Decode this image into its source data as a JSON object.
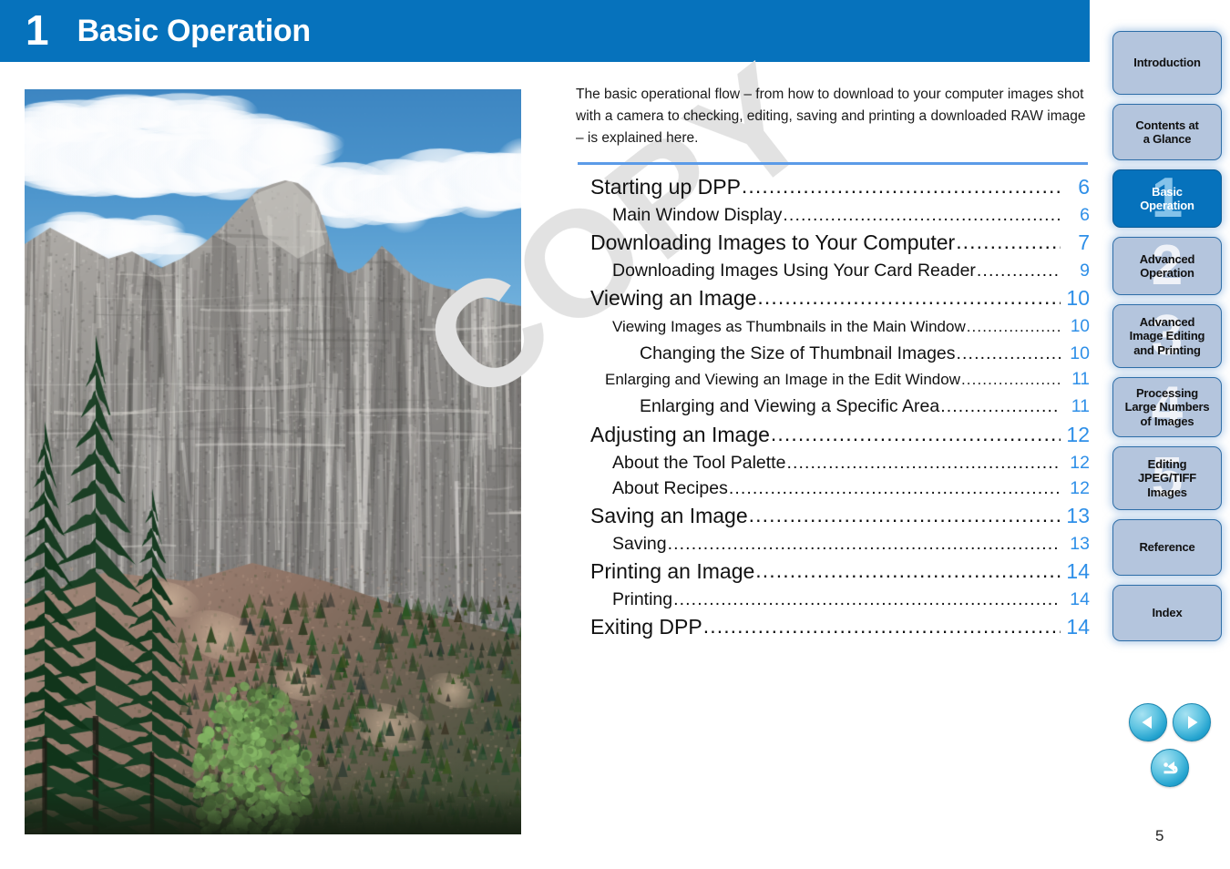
{
  "header": {
    "chapter_number": "1",
    "title": "Basic Operation",
    "background_color": "#0672bc"
  },
  "photo": {
    "alt": "mountain-landscape-photo",
    "description": "Rocky mountain peak with blue sky, white clouds and evergreen trees in the foreground"
  },
  "watermark": {
    "text": "COPY",
    "color": "#e2e2e2"
  },
  "intro": {
    "text": "The basic operational flow – from how to download to your computer images shot with a camera to checking, editing, saving and printing a downloaded RAW image – is explained here."
  },
  "toc": {
    "divider_color": "#5b9be8",
    "page_color": "#2e8fe8",
    "leader": "...........................................................................................................",
    "entries": [
      {
        "label": "Starting up DPP",
        "page": "6",
        "level": "lvl1"
      },
      {
        "label": "Main Window Display",
        "page": "6",
        "level": "lvl2"
      },
      {
        "label": "Downloading Images to Your Computer",
        "page": "7",
        "level": "lvl1"
      },
      {
        "label": "Downloading Images Using Your Card Reader",
        "page": "9",
        "level": "lvl2"
      },
      {
        "label": "Viewing an Image",
        "page": "10",
        "level": "lvl1"
      },
      {
        "label": "Viewing Images as Thumbnails in the Main Window",
        "page": "10",
        "level": "lvl2c"
      },
      {
        "label": "Changing the Size of Thumbnail Images",
        "page": "10",
        "level": "lvl3"
      },
      {
        "label": "Enlarging and Viewing an Image in the Edit Window",
        "page": "11",
        "level": "lvl3c"
      },
      {
        "label": "Enlarging and Viewing a Specific Area",
        "page": "11",
        "level": "lvl3"
      },
      {
        "label": "Adjusting an Image",
        "page": "12",
        "level": "lvl1"
      },
      {
        "label": "About the Tool Palette",
        "page": "12",
        "level": "lvl2"
      },
      {
        "label": "About Recipes",
        "page": "12",
        "level": "lvl2"
      },
      {
        "label": "Saving an Image",
        "page": "13",
        "level": "lvl1"
      },
      {
        "label": "Saving",
        "page": "13",
        "level": "lvl2"
      },
      {
        "label": "Printing an Image",
        "page": "14",
        "level": "lvl1"
      },
      {
        "label": "Printing",
        "page": "14",
        "level": "lvl2"
      },
      {
        "label": "Exiting DPP",
        "page": "14",
        "level": "lvl1"
      }
    ]
  },
  "sidebar": {
    "active_color": "#0672bc",
    "inactive_color": "#b4c5dd",
    "items": [
      {
        "label": "Introduction",
        "watermark": "",
        "active": false,
        "size": "h-intro",
        "name": "introduction"
      },
      {
        "label": "Contents at\na Glance",
        "watermark": "",
        "active": false,
        "size": "h-contents",
        "name": "contents-at-a-glance"
      },
      {
        "label": "Basic\nOperation",
        "watermark": "1",
        "active": true,
        "size": "h-basic",
        "name": "basic-operation"
      },
      {
        "label": "Advanced\nOperation",
        "watermark": "2",
        "active": false,
        "size": "h-advop",
        "name": "advanced-operation"
      },
      {
        "label": "Advanced\nImage Editing\nand Printing",
        "watermark": "3",
        "active": false,
        "size": "h-advimg",
        "name": "advanced-image-editing-and-printing"
      },
      {
        "label": "Processing\nLarge Numbers\nof Images",
        "watermark": "4",
        "active": false,
        "size": "h-proc",
        "name": "processing-large-numbers-of-images"
      },
      {
        "label": "Editing\nJPEG/TIFF\nImages",
        "watermark": "5",
        "active": false,
        "size": "h-jpeg",
        "name": "editing-jpeg-tiff-images"
      },
      {
        "label": "Reference",
        "watermark": "",
        "active": false,
        "size": "h-ref",
        "name": "reference"
      },
      {
        "label": "Index",
        "watermark": "",
        "active": false,
        "size": "h-index",
        "name": "index"
      }
    ]
  },
  "navigation": {
    "previous_icon": "triangle-left-icon",
    "next_icon": "triangle-right-icon",
    "return_icon": "return-back-icon"
  },
  "footer": {
    "page_number": "5"
  }
}
